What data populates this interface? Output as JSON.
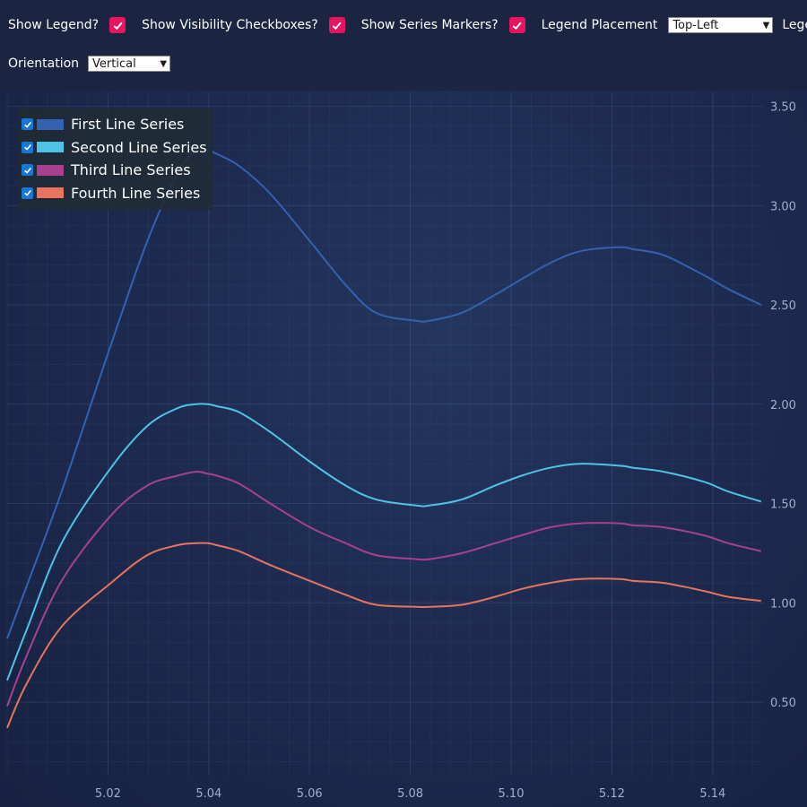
{
  "toolbar": {
    "show_legend_label": "Show Legend?",
    "show_visibility_label": "Show Visibility Checkboxes?",
    "show_markers_label": "Show Series Markers?",
    "legend_placement_label": "Legend Placement",
    "legend_placement_value": "Top-Left",
    "legend_label": "Legend",
    "orientation_label": "Orientation",
    "orientation_value": "Vertical",
    "checkbox_color": "#e9145f"
  },
  "chart_data": {
    "type": "line",
    "title": "",
    "xlabel": "",
    "ylabel": "",
    "xlim": [
      5.0,
      5.15
    ],
    "ylim": [
      0.13,
      3.57
    ],
    "x_ticks": [
      "5.02",
      "5.04",
      "5.06",
      "5.08",
      "5.10",
      "5.12",
      "5.14"
    ],
    "y_ticks": [
      "0.50",
      "1.00",
      "1.50",
      "2.00",
      "2.50",
      "3.00",
      "3.50"
    ],
    "y_axis_position": "right",
    "legend_position": "top-left",
    "grid": true,
    "series": [
      {
        "name": "First Line Series",
        "color": "#3461b0",
        "x": [
          5.0,
          5.0038,
          5.0108,
          5.0206,
          5.0278,
          5.0338,
          5.0375,
          5.0398,
          5.0416,
          5.046,
          5.0522,
          5.0601,
          5.0672,
          5.0732,
          5.0812,
          5.0838,
          5.0902,
          5.0968,
          5.1021,
          5.1077,
          5.1137,
          5.1215,
          5.1243,
          5.1303,
          5.1382,
          5.1431,
          5.1496
        ],
        "values": [
          0.82,
          1.08,
          1.56,
          2.3,
          2.82,
          3.16,
          3.28,
          3.28,
          3.26,
          3.2,
          3.06,
          2.82,
          2.6,
          2.46,
          2.42,
          2.42,
          2.46,
          2.55,
          2.63,
          2.71,
          2.77,
          2.79,
          2.78,
          2.75,
          2.65,
          2.58,
          2.5
        ]
      },
      {
        "name": "Second Line Series",
        "color": "#4fc3e6",
        "x": [
          5.0,
          5.0038,
          5.0108,
          5.0206,
          5.0278,
          5.0338,
          5.0375,
          5.0398,
          5.0416,
          5.046,
          5.0522,
          5.0601,
          5.0672,
          5.0732,
          5.0812,
          5.0838,
          5.0902,
          5.0968,
          5.1021,
          5.1077,
          5.1137,
          5.1215,
          5.1243,
          5.1303,
          5.1382,
          5.1431,
          5.1496
        ],
        "values": [
          0.61,
          0.86,
          1.3,
          1.68,
          1.89,
          1.98,
          2.0,
          2.0,
          1.99,
          1.96,
          1.86,
          1.71,
          1.59,
          1.52,
          1.49,
          1.49,
          1.52,
          1.59,
          1.64,
          1.68,
          1.7,
          1.69,
          1.68,
          1.66,
          1.61,
          1.56,
          1.51
        ]
      },
      {
        "name": "Third Line Series",
        "color": "#a8418d",
        "x": [
          5.0,
          5.0038,
          5.0108,
          5.0206,
          5.0278,
          5.0338,
          5.0375,
          5.0398,
          5.0416,
          5.046,
          5.0522,
          5.0601,
          5.0672,
          5.0732,
          5.0812,
          5.0838,
          5.0902,
          5.0968,
          5.1021,
          5.1077,
          5.1137,
          5.1215,
          5.1243,
          5.1303,
          5.1382,
          5.1431,
          5.1496
        ],
        "values": [
          0.48,
          0.73,
          1.11,
          1.44,
          1.59,
          1.64,
          1.66,
          1.65,
          1.64,
          1.6,
          1.5,
          1.38,
          1.3,
          1.24,
          1.22,
          1.22,
          1.25,
          1.3,
          1.34,
          1.38,
          1.4,
          1.4,
          1.39,
          1.38,
          1.34,
          1.3,
          1.26
        ]
      },
      {
        "name": "Fourth Line Series",
        "color": "#e8735f",
        "x": [
          5.0,
          5.0038,
          5.0108,
          5.0206,
          5.0278,
          5.0338,
          5.0375,
          5.0398,
          5.0416,
          5.046,
          5.0522,
          5.0601,
          5.0672,
          5.0732,
          5.0812,
          5.0838,
          5.0902,
          5.0968,
          5.1021,
          5.1077,
          5.1137,
          5.1215,
          5.1243,
          5.1303,
          5.1382,
          5.1431,
          5.1496
        ],
        "values": [
          0.37,
          0.59,
          0.88,
          1.1,
          1.24,
          1.29,
          1.3,
          1.3,
          1.29,
          1.26,
          1.19,
          1.11,
          1.04,
          0.99,
          0.98,
          0.98,
          0.99,
          1.03,
          1.07,
          1.1,
          1.12,
          1.12,
          1.11,
          1.1,
          1.06,
          1.03,
          1.01
        ]
      }
    ]
  }
}
